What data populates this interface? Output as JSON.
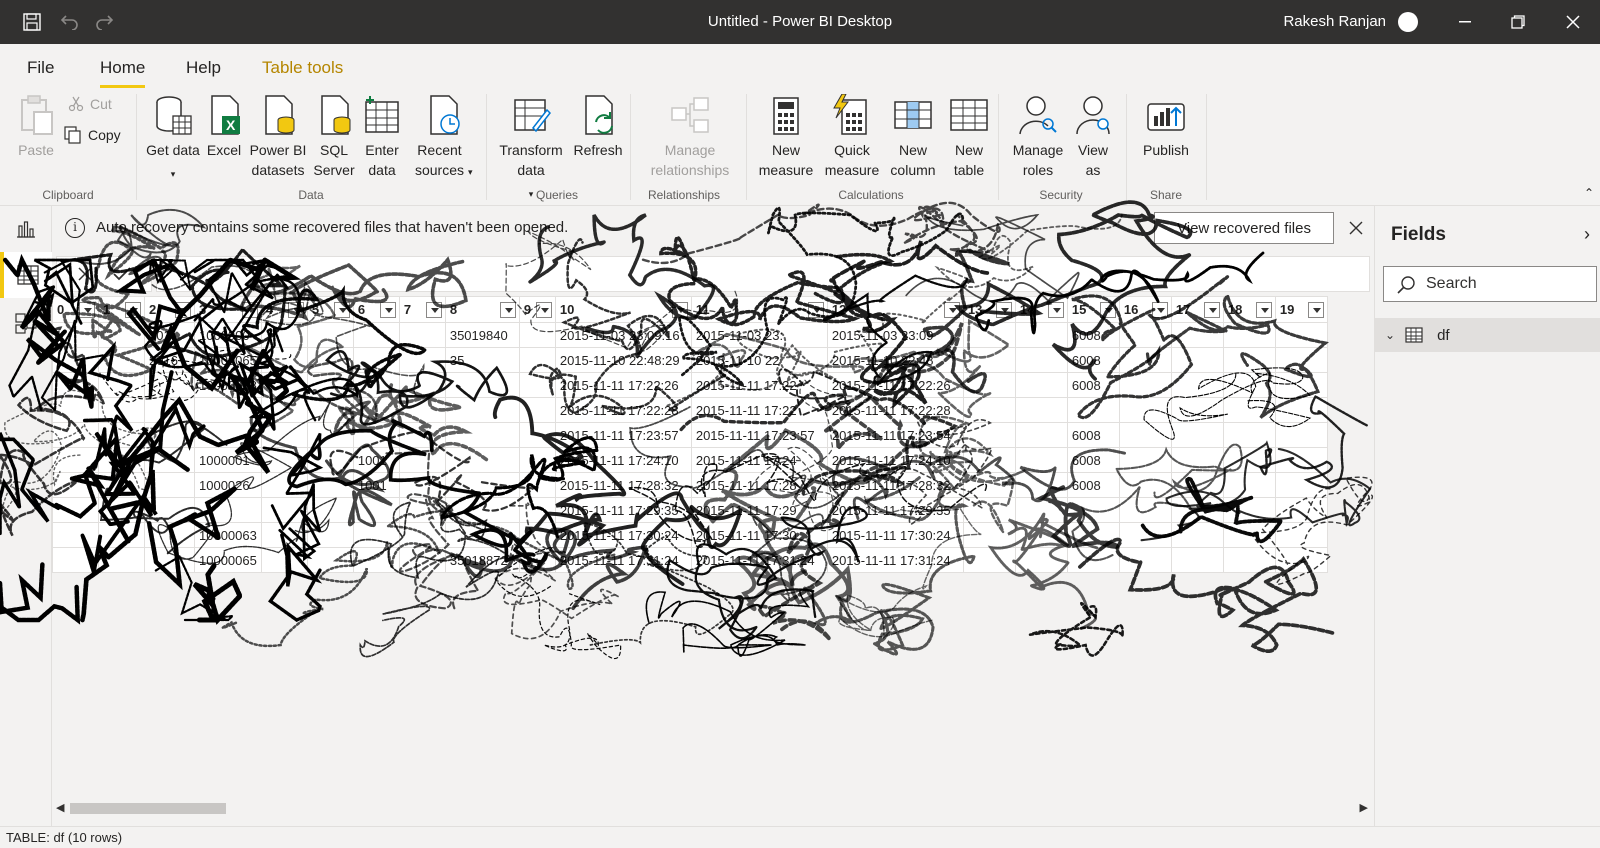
{
  "window": {
    "title": "Untitled - Power BI Desktop",
    "user_name": "Rakesh Ranjan"
  },
  "menu": {
    "tabs": [
      {
        "label": "File"
      },
      {
        "label": "Home"
      },
      {
        "label": "Help"
      },
      {
        "label": "Table tools"
      }
    ]
  },
  "ribbon": {
    "clipboard": {
      "paste": "Paste",
      "cut": "Cut",
      "copy": "Copy",
      "group": "Clipboard"
    },
    "data": {
      "get_data": "Get data",
      "excel": "Excel",
      "pbi_datasets": "Power BI datasets",
      "sql_server": "SQL Server",
      "enter_data": "Enter data",
      "recent_sources": "Recent sources",
      "group": "Data"
    },
    "queries": {
      "transform": "Transform data",
      "refresh": "Refresh",
      "group": "Queries"
    },
    "relationships": {
      "manage": "Manage relationships",
      "group": "Relationships"
    },
    "calculations": {
      "new_measure": "New measure",
      "quick_measure": "Quick measure",
      "new_column": "New column",
      "new_table": "New table",
      "group": "Calculations"
    },
    "security": {
      "manage_roles": "Manage roles",
      "view_as": "View as",
      "group": "Security"
    },
    "share": {
      "publish": "Publish",
      "group": "Share"
    }
  },
  "notification": {
    "message": "Auto recovery contains some recovered files that haven't been opened.",
    "button": "View recovered files"
  },
  "grid": {
    "columns": [
      "0",
      "1",
      "2",
      "3",
      "4",
      "5",
      "6",
      "7",
      "8",
      "9",
      "10",
      "11",
      "12",
      "13",
      "14",
      "15",
      "16",
      "17",
      "18",
      "19"
    ],
    "rows": [
      [
        "",
        "",
        "201",
        "1000000",
        "",
        "",
        "",
        "",
        "35019840",
        "",
        "2015-11-03 23:09:16",
        "2015-11-03 23:",
        "2015-11-03 23:09",
        "",
        "",
        "6008",
        "",
        "",
        "",
        ""
      ],
      [
        "",
        "",
        "2016",
        "10000065",
        "",
        "",
        "",
        "",
        "35",
        "",
        "2015-11-10 22:48:29",
        "2015-11-10 22",
        "2015-11-10 22:48",
        "",
        "",
        "6008",
        "",
        "",
        "",
        ""
      ],
      [
        "",
        "",
        "",
        "10000068",
        "",
        "",
        "",
        "",
        "",
        "",
        "2015-11-11 17:22:26",
        "2015-11-11 17:22",
        "2015-11-11 17:22:26",
        "",
        "",
        "6008",
        "",
        "",
        "",
        ""
      ],
      [
        "",
        "",
        "",
        "",
        "",
        "",
        "",
        "",
        "",
        "",
        "2015-11-11 17:22:28",
        "2015-11-11 17:22",
        "2015-11-11 17:22:28",
        "",
        "",
        "",
        "",
        "",
        "",
        ""
      ],
      [
        "",
        "",
        "",
        "",
        "",
        "",
        "",
        "",
        "",
        "",
        "2015-11-11 17:23:57",
        "2015-11-11 17:23:57",
        "2015-11-11 17:23:54",
        "",
        "",
        "6008",
        "",
        "",
        "",
        ""
      ],
      [
        "",
        "",
        "",
        "1000001",
        "",
        "",
        "1001",
        "",
        "",
        "",
        "2015-11-11 17:24:10",
        "2015-11-11 17:24",
        "2015-11-11 17:24:10",
        "",
        "",
        "6008",
        "",
        "",
        "",
        ""
      ],
      [
        "",
        "",
        "",
        "1000026",
        "",
        "",
        "1001",
        "",
        "",
        "",
        "2015-11-11 17:28:32",
        "2015-11-11 17:28",
        "2015-11-11 17:28:32",
        "",
        "",
        "6008",
        "",
        "",
        "",
        ""
      ],
      [
        "",
        "",
        "",
        "",
        "",
        "",
        "",
        "",
        "",
        "",
        "2015-11-11 17:29:35",
        "2015-11-11 17:29",
        "2015-11-11 17:29:35",
        "",
        "",
        "",
        "",
        "",
        "",
        ""
      ],
      [
        "",
        "",
        "",
        "10000063",
        "",
        "",
        "",
        "",
        "",
        "",
        "2015-11-11 17:30:24",
        "2015-11-11 17:30",
        "2015-11-11 17:30:24",
        "",
        "",
        "",
        "",
        "",
        "",
        ""
      ],
      [
        "",
        "",
        "",
        "10000065",
        "",
        "",
        "",
        "",
        "35018872",
        "",
        "2015-11-11 17:31:24",
        "2015-11-11 17:31:24",
        "2015-11-11 17:31:24",
        "",
        "",
        "",
        "",
        "",
        "",
        ""
      ]
    ]
  },
  "fields_pane": {
    "title": "Fields",
    "search_placeholder": "Search",
    "table_name": "df"
  },
  "status": {
    "text": "TABLE: df (10 rows)"
  },
  "colors": {
    "titlebar": "#323130",
    "accent_yellow": "#f2c811",
    "context_tab": "#b58600"
  }
}
